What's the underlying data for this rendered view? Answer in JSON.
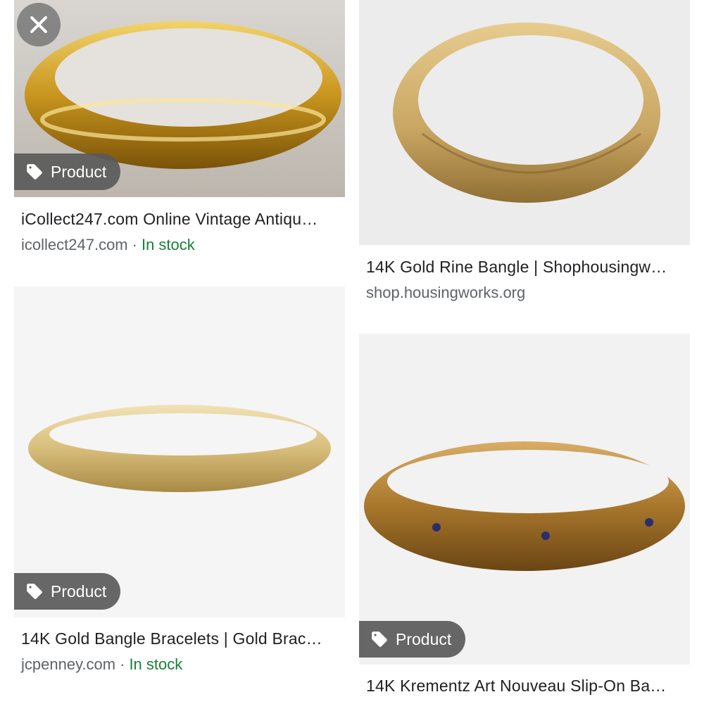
{
  "results": [
    {
      "badge": "Product",
      "title": "iCollect247.com Online Vintage Antiqu…",
      "source": "icollect247.com",
      "separator": "·",
      "stock": "In stock"
    },
    {
      "badge": "",
      "title": "14K Gold Rine Bangle | Shophousingw…",
      "source": "shop.housingworks.org",
      "separator": "",
      "stock": ""
    },
    {
      "badge": "Product",
      "title": "14K Gold Bangle Bracelets | Gold Brac…",
      "source": "jcpenney.com",
      "separator": "·",
      "stock": "In stock"
    },
    {
      "badge": "Product",
      "title": "14K Krementz Art Nouveau Slip-On Ba…",
      "source": "",
      "separator": "",
      "stock": ""
    }
  ],
  "icons": {
    "close": "close-icon",
    "tag": "tag-icon"
  },
  "colors": {
    "in_stock": "#188038",
    "badge_bg": "#5a5a5a",
    "title": "#202124",
    "meta": "#5f6368"
  }
}
